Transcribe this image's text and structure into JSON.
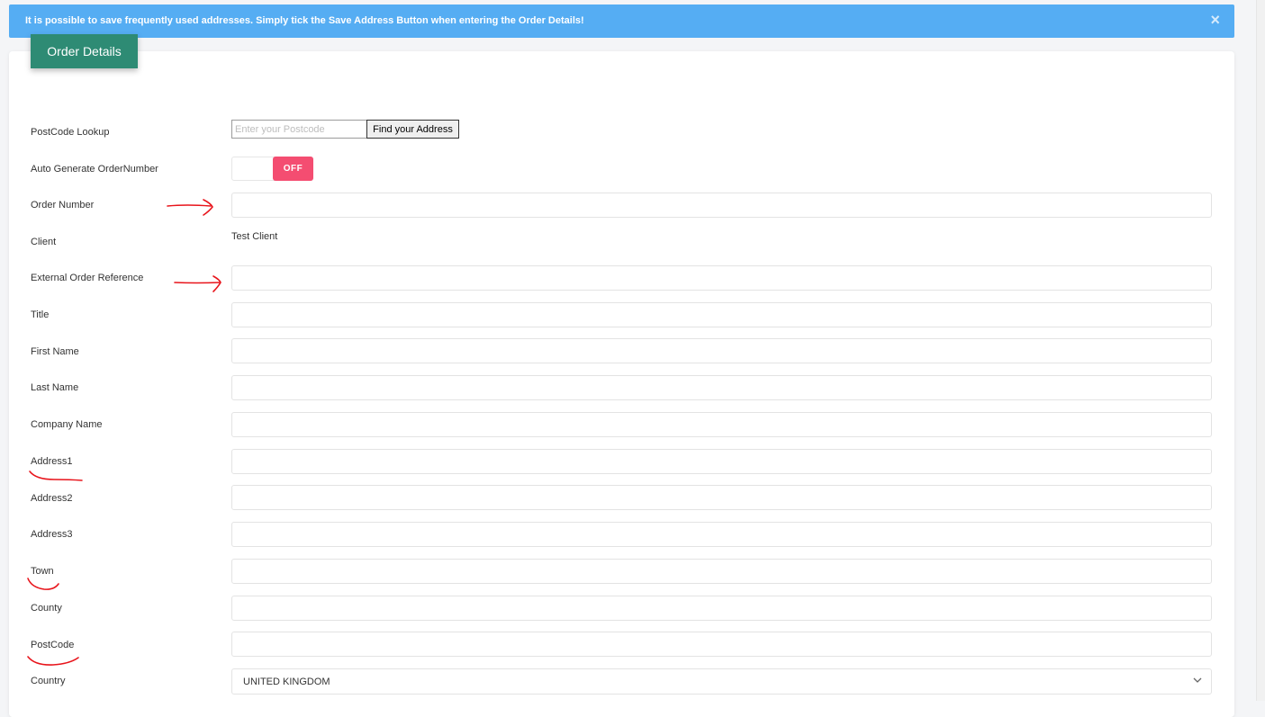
{
  "alert": {
    "message": "It is possible to save frequently used addresses. Simply tick the Save Address Button when entering the Order Details!",
    "close_symbol": "×"
  },
  "card": {
    "tab_label": "Order Details"
  },
  "postcode_lookup": {
    "label": "PostCode Lookup",
    "placeholder": "Enter your Postcode",
    "button_label": "Find your Address"
  },
  "auto_generate": {
    "label": "Auto Generate OrderNumber",
    "toggle_text": "OFF",
    "state": "off"
  },
  "fields": {
    "order_number": {
      "label": "Order Number",
      "value": ""
    },
    "client": {
      "label": "Client",
      "value": "Test Client"
    },
    "external_ref": {
      "label": "External Order Reference",
      "value": ""
    },
    "title": {
      "label": "Title",
      "value": ""
    },
    "first_name": {
      "label": "First Name",
      "value": ""
    },
    "last_name": {
      "label": "Last Name",
      "value": ""
    },
    "company_name": {
      "label": "Company Name",
      "value": ""
    },
    "address1": {
      "label": "Address1",
      "value": ""
    },
    "address2": {
      "label": "Address2",
      "value": ""
    },
    "address3": {
      "label": "Address3",
      "value": ""
    },
    "town": {
      "label": "Town",
      "value": ""
    },
    "county": {
      "label": "County",
      "value": ""
    },
    "postcode": {
      "label": "PostCode",
      "value": ""
    },
    "country": {
      "label": "Country",
      "value": "UNITED KINGDOM"
    }
  },
  "colors": {
    "alert_bg": "#55adf3",
    "tab_bg": "#2e8b74",
    "toggle_off_bg": "#f44d71",
    "annotation": "#e8141b"
  },
  "icons": {
    "alert_close": "close-icon",
    "select": "chevron-down-icon"
  }
}
